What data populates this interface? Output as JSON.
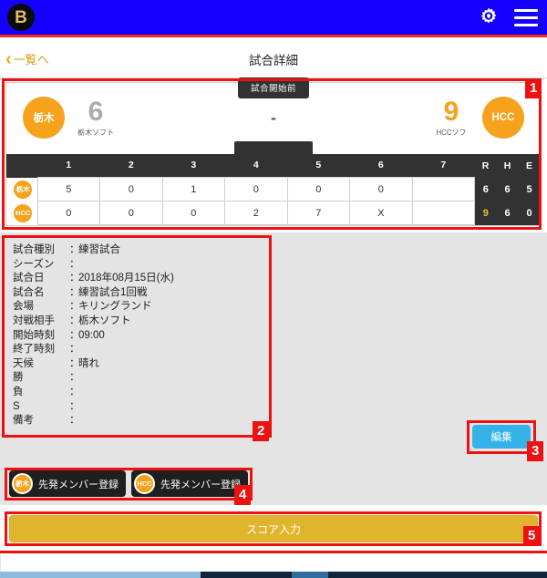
{
  "app": {
    "logo_text": "B",
    "gear_icon": "gear-icon",
    "menu_icon": "hamburger-menu-icon"
  },
  "subheader": {
    "back_label": "一覧へ",
    "back_chevron": "‹",
    "title": "試合詳細"
  },
  "scoreboard": {
    "status": "試合開始前",
    "dash": "-",
    "home": {
      "abbr": "栃木",
      "score": "6",
      "name": "栃木ソフト",
      "result": "loser"
    },
    "away": {
      "abbr": "HCC",
      "score": "9",
      "name": "HCCソフ",
      "result": "winner"
    },
    "innings_header": [
      "1",
      "2",
      "3",
      "4",
      "5",
      "6",
      "7"
    ],
    "rhe_header": [
      "R",
      "H",
      "E"
    ],
    "rows": [
      {
        "abbr": "栃木",
        "innings": [
          "5",
          "0",
          "1",
          "0",
          "0",
          "0",
          ""
        ],
        "r": "6",
        "h": "6",
        "e": "5",
        "highlight_r": false
      },
      {
        "abbr": "HCC",
        "innings": [
          "0",
          "0",
          "0",
          "2",
          "7",
          "X",
          ""
        ],
        "r": "9",
        "h": "6",
        "e": "0",
        "highlight_r": true
      }
    ]
  },
  "details": {
    "separator": "：",
    "rows": [
      {
        "label": "試合種別",
        "value": "練習試合"
      },
      {
        "label": "シーズン",
        "value": ""
      },
      {
        "label": "試合日",
        "value": "2018年08月15日(水)"
      },
      {
        "label": "試合名",
        "value": "練習試合1回戦"
      },
      {
        "label": "会場",
        "value": "キリングランド"
      },
      {
        "label": "対戦相手",
        "value": "栃木ソフト"
      },
      {
        "label": "開始時刻",
        "value": "09:00"
      },
      {
        "label": "終了時刻",
        "value": ""
      },
      {
        "label": "天候",
        "value": "晴れ"
      },
      {
        "label": "勝",
        "value": ""
      },
      {
        "label": "負",
        "value": ""
      },
      {
        "label": "S",
        "value": ""
      },
      {
        "label": "備考",
        "value": ""
      }
    ]
  },
  "actions": {
    "edit_label": "編集",
    "member_home": {
      "abbr": "栃木",
      "label": "先発メンバー登録"
    },
    "member_away": {
      "abbr": "HCC",
      "label": "先発メンバー登録"
    },
    "score_input_label": "スコア入力"
  },
  "annotations": [
    {
      "id": "1",
      "target": "scoreboard"
    },
    {
      "id": "2",
      "target": "details-panel"
    },
    {
      "id": "3",
      "target": "edit-button"
    },
    {
      "id": "4",
      "target": "member-buttons"
    },
    {
      "id": "5",
      "target": "score-input-button"
    }
  ],
  "colors": {
    "appbar": "#1500ff",
    "accent_red": "#ee1111",
    "team_orange": "#f6a21c",
    "edit_blue": "#35b3e8",
    "score_gold": "#e0b52d",
    "dark": "#323232"
  }
}
